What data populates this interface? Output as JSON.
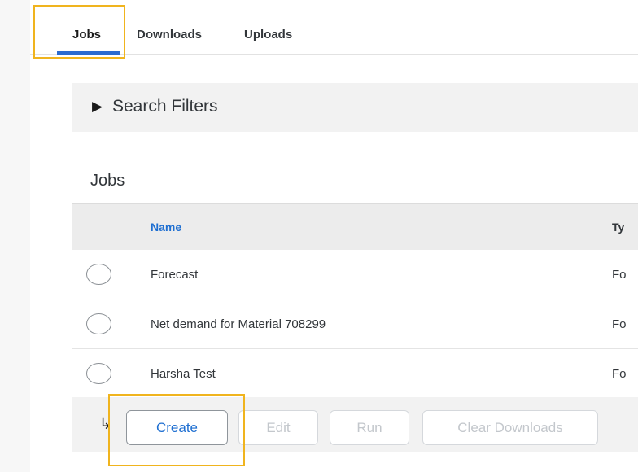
{
  "tabs": {
    "jobs": "Jobs",
    "downloads": "Downloads",
    "uploads": "Uploads",
    "active": "Jobs"
  },
  "filters": {
    "arrow_icon": "triangle-right-icon",
    "label": "Search Filters"
  },
  "section": {
    "title": "Jobs"
  },
  "table": {
    "headers": {
      "name": "Name",
      "type": "Ty"
    },
    "rows": [
      {
        "name": "Forecast",
        "type": "Fo"
      },
      {
        "name": "Net demand for Material 708299",
        "type": "Fo"
      },
      {
        "name": "Harsha Test",
        "type": "Fo"
      }
    ]
  },
  "toolbar": {
    "return_icon": "return-arrow-icon",
    "create": "Create",
    "edit": "Edit",
    "run": "Run",
    "clear": "Clear Downloads"
  },
  "colors": {
    "accent": "#2a6bd1",
    "highlight": "#f0b41e",
    "link": "#1f6fd1"
  }
}
